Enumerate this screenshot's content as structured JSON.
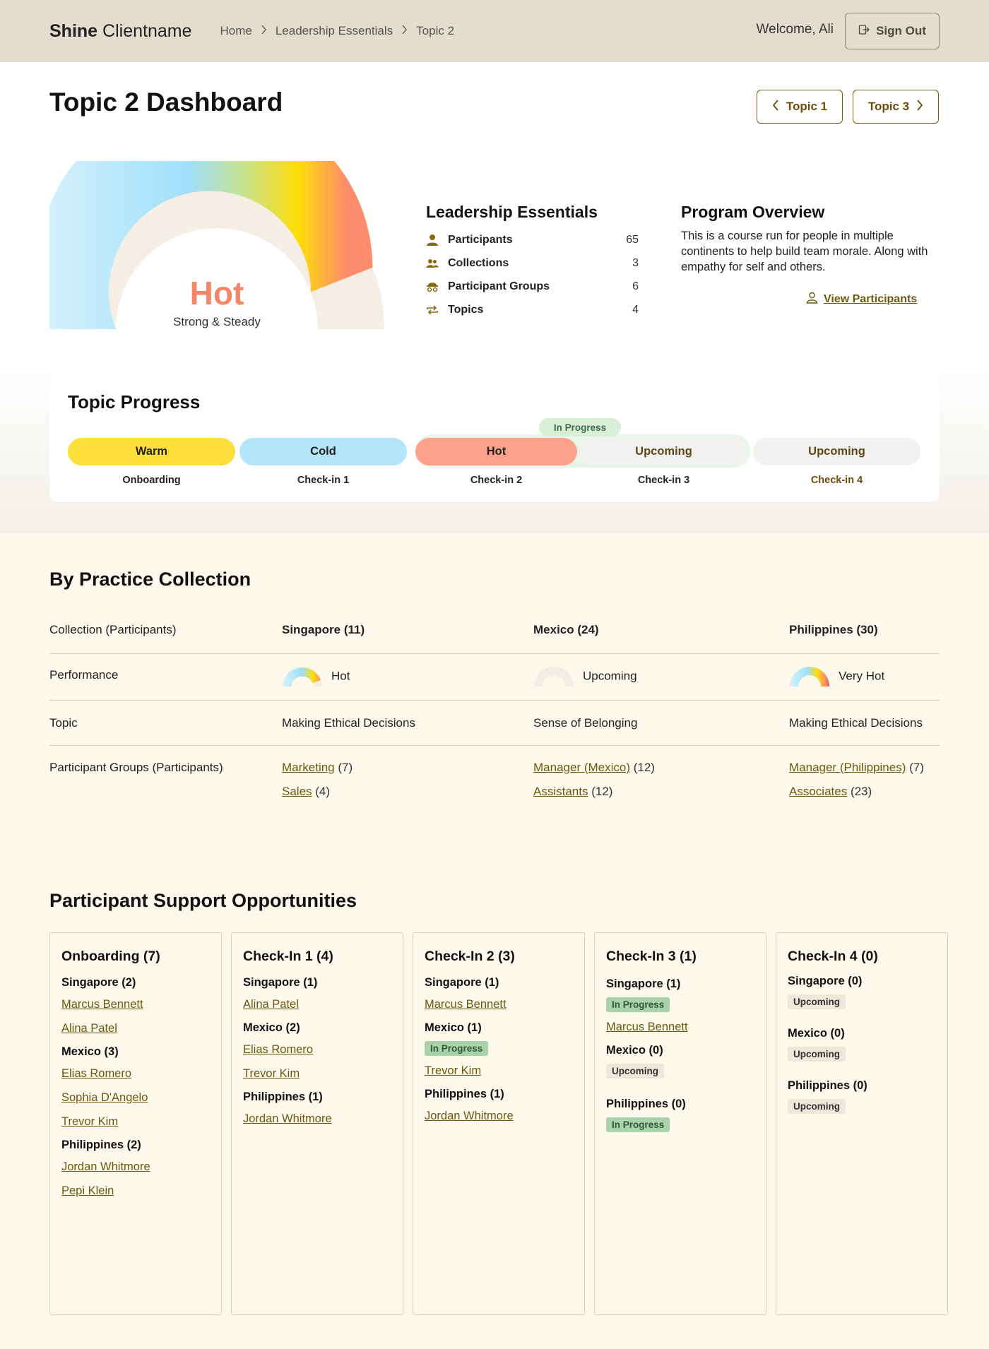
{
  "header": {
    "brand_bold": "Shine",
    "brand_light": "Clientname",
    "breadcrumb": [
      "Home",
      "Leadership Essentials",
      "Topic 2"
    ],
    "welcome": "Welcome, Ali",
    "sign_out": "Sign Out"
  },
  "page": {
    "title": "Topic 2 Dashboard",
    "prev_topic": "Topic 1",
    "next_topic": "Topic 3"
  },
  "gauge": {
    "value_label": "Hot",
    "sub_label": "Strong & Steady",
    "level_fraction": 0.88,
    "value_color": "#f2866a"
  },
  "summary": {
    "title": "Leadership Essentials",
    "stats": [
      {
        "label": "Participants",
        "value": "65",
        "icon": "person-icon"
      },
      {
        "label": "Collections",
        "value": "3",
        "icon": "people-icon"
      },
      {
        "label": "Participant Groups",
        "value": "6",
        "icon": "groups-icon"
      },
      {
        "label": "Topics",
        "value": "4",
        "icon": "repeat-icon"
      }
    ]
  },
  "overview": {
    "title": "Program Overview",
    "text": "This is a course run for people in multiple continents to help build team morale. Along with empathy for self and others.",
    "link": "View Participants"
  },
  "topic_progress": {
    "title": "Topic Progress",
    "current_tag": "In Progress",
    "steps": [
      {
        "status": "Warm",
        "label": "Onboarding",
        "color": "#fddf3c"
      },
      {
        "status": "Cold",
        "label": "Check-in 1",
        "color": "#b3e6fb"
      },
      {
        "status": "Hot",
        "label": "Check-in 2",
        "color": "#fda18a"
      },
      {
        "status": "Upcoming",
        "label": "Check-in 3",
        "color": "#f2f1ef"
      },
      {
        "status": "Upcoming",
        "label": "Check-in 4",
        "color": "#f2f1ef"
      }
    ]
  },
  "practice": {
    "title": "By Practice Collection",
    "row_labels": [
      "Collection (Participants)",
      "Performance",
      "Topic",
      "Participant Groups (Participants)"
    ],
    "collections": [
      {
        "name": "Singapore (11)",
        "performance": "Hot",
        "topic": "Making Ethical Decisions",
        "groups": [
          {
            "name": "Marketing",
            "count": "(7)"
          },
          {
            "name": "Sales",
            "count": "(4)"
          }
        ]
      },
      {
        "name": "Mexico (24)",
        "performance": "Upcoming",
        "topic": "Sense of Belonging",
        "groups": [
          {
            "name": "Manager (Mexico)",
            "count": "(12)"
          },
          {
            "name": "Assistants",
            "count": "(12)"
          }
        ]
      },
      {
        "name": "Philippines (30)",
        "performance": "Very Hot",
        "topic": "Making Ethical Decisions",
        "groups": [
          {
            "name": "Manager (Philippines)",
            "count": "(7)"
          },
          {
            "name": "Associates",
            "count": "(23)"
          }
        ]
      }
    ]
  },
  "support": {
    "title": "Participant Support Opportunities",
    "columns": [
      {
        "title": "Onboarding (7)",
        "groups": [
          {
            "name": "Singapore (2)",
            "people": [
              "Marcus Bennett",
              "Alina Patel"
            ]
          },
          {
            "name": "Mexico (3)",
            "people": [
              "Elias Romero",
              "Sophia D'Angelo",
              "Trevor Kim"
            ]
          },
          {
            "name": "Philippines (2)",
            "people": [
              "Jordan Whitmore",
              "Pepi Klein"
            ]
          }
        ]
      },
      {
        "title": "Check-In 1 (4)",
        "groups": [
          {
            "name": "Singapore (1)",
            "people": [
              "Alina Patel"
            ]
          },
          {
            "name": "Mexico (2)",
            "people": [
              "Elias Romero",
              "Trevor Kim"
            ]
          },
          {
            "name": "Philippines (1)",
            "people": [
              "Jordan Whitmore"
            ]
          }
        ]
      },
      {
        "title": "Check-In 2 (3)",
        "groups": [
          {
            "name": "Singapore (1)",
            "people": [
              "Marcus Bennett"
            ]
          },
          {
            "name": "Mexico (1)",
            "badge": "In Progress",
            "people": [
              "Trevor Kim"
            ]
          },
          {
            "name": "Philippines (1)",
            "people": [
              "Jordan Whitmore"
            ]
          }
        ]
      },
      {
        "title": "Check-In 3 (1)",
        "groups": [
          {
            "name": "Singapore (1)",
            "badge": "In Progress",
            "people": [
              "Marcus Bennett"
            ]
          },
          {
            "name": "Mexico (0)",
            "badge_up": "Upcoming",
            "people": []
          },
          {
            "name": "Philippines (0)",
            "badge": "In Progress",
            "people": []
          }
        ]
      },
      {
        "title": "Check-In 4 (0)",
        "groups": [
          {
            "name": "Singapore (0)",
            "badge_up": "Upcoming",
            "people": []
          },
          {
            "name": "Mexico (0)",
            "badge_up": "Upcoming",
            "people": []
          },
          {
            "name": "Philippines (0)",
            "badge_up": "Upcoming",
            "people": []
          }
        ]
      }
    ]
  }
}
